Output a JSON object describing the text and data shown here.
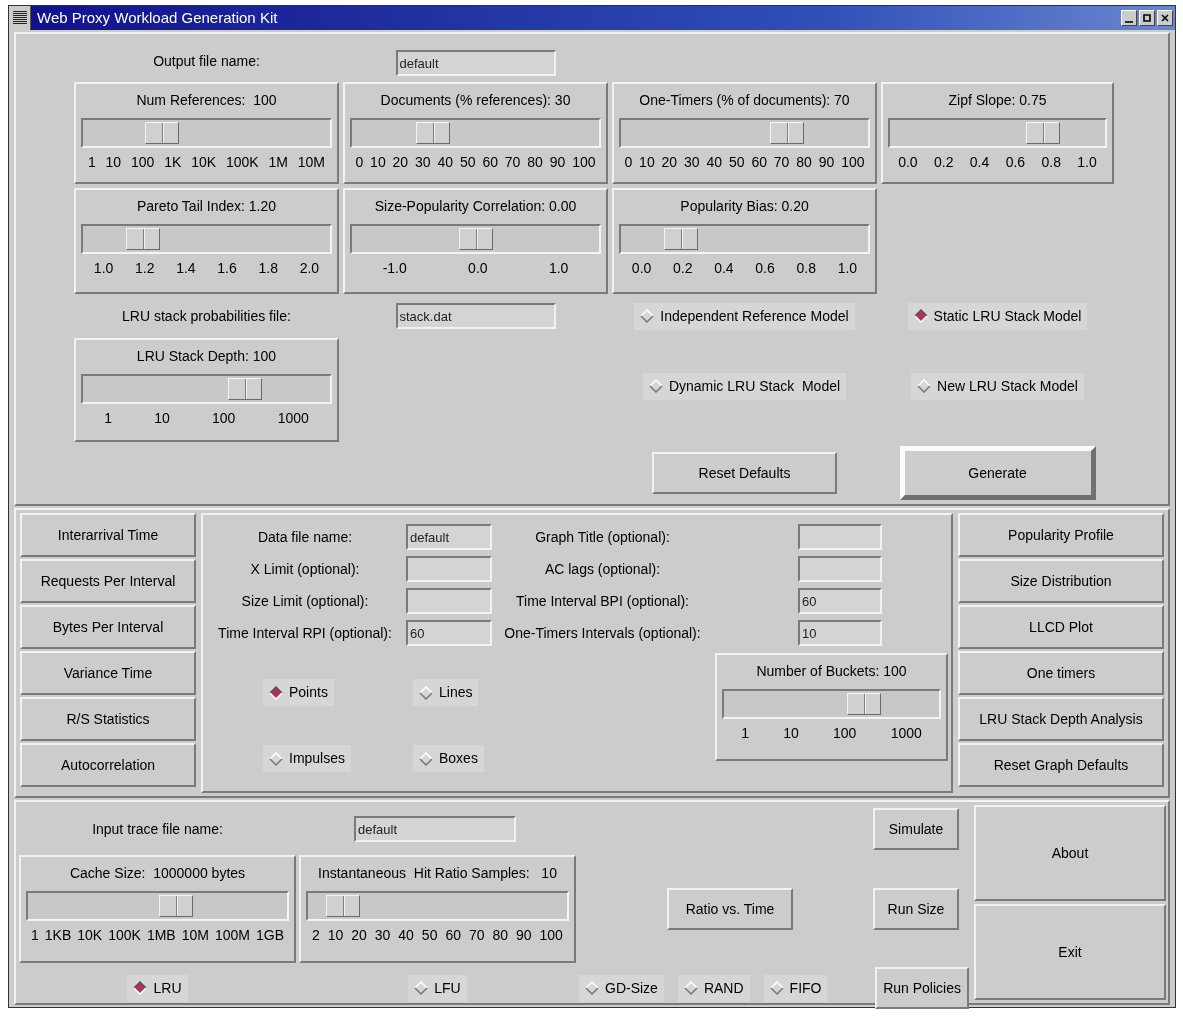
{
  "window": {
    "title": "Web Proxy Workload Generation Kit"
  },
  "generator": {
    "output_file": {
      "label": "Output file name:",
      "value": "default"
    },
    "scales": [
      {
        "label": "Num References:  100",
        "level": 0.29,
        "ticks": [
          "1",
          "10",
          "100",
          "1K",
          "10K",
          "100K",
          "1M",
          "10M"
        ]
      },
      {
        "label": "Documents (% references): 30",
        "level": 0.3,
        "ticks": [
          "0",
          "10",
          "20",
          "30",
          "40",
          "50",
          "60",
          "70",
          "80",
          "90",
          "100"
        ]
      },
      {
        "label": "One-Timers (% of documents): 70",
        "level": 0.7,
        "ticks": [
          "0",
          "10",
          "20",
          "30",
          "40",
          "50",
          "60",
          "70",
          "80",
          "90",
          "100"
        ]
      },
      {
        "label": "Zipf Slope: 0.75",
        "level": 0.75,
        "ticks": [
          "0.0",
          "0.2",
          "0.4",
          "0.6",
          "0.8",
          "1.0"
        ]
      },
      {
        "label": "Pareto Tail Index: 1.20",
        "level": 0.2,
        "ticks": [
          "1.0",
          "1.2",
          "1.4",
          "1.6",
          "1.8",
          "2.0"
        ]
      },
      {
        "label": "Size-Popularity Correlation: 0.00",
        "level": 0.5,
        "ticks": [
          "-1.0",
          "0.0",
          "1.0"
        ]
      },
      {
        "label": "Popularity Bias: 0.20",
        "level": 0.2,
        "ticks": [
          "0.0",
          "0.2",
          "0.4",
          "0.6",
          "0.8",
          "1.0"
        ]
      }
    ],
    "lru_file": {
      "label": "LRU stack probabilities file:",
      "value": "stack.dat"
    },
    "lru_depth": {
      "label": "LRU Stack Depth: 100",
      "level": 0.68,
      "ticks": [
        "1",
        "10",
        "100",
        "1000"
      ]
    },
    "models": [
      {
        "label": "Independent Reference Model",
        "selected": false
      },
      {
        "label": "Static LRU Stack Model",
        "selected": true
      },
      {
        "label": "Dynamic LRU Stack  Model",
        "selected": false
      },
      {
        "label": "New LRU Stack Model",
        "selected": false
      }
    ],
    "buttons": [
      "Reset Defaults",
      "Generate"
    ]
  },
  "analysis": {
    "plot_buttons": [
      "Interarrival Time",
      "Requests Per Interval",
      "Bytes Per Interval",
      "Variance Time",
      "R/S Statistics",
      "Autocorrelation"
    ],
    "fields": [
      {
        "label": "Data file name:",
        "value": "default"
      },
      {
        "label": "Graph Title (optional):"
      },
      {
        "label": "X Limit (optional):"
      },
      {
        "label": "AC lags (optional):"
      },
      {
        "label": "Size Limit (optional):"
      },
      {
        "label": "Time Interval BPI (optional):",
        "value": "60"
      },
      {
        "label": "Time Interval RPI (optional):",
        "value": "60"
      },
      {
        "label": "One-Timers Intervals (optional):",
        "value": "10"
      }
    ],
    "styles": [
      {
        "label": "Points",
        "selected": true
      },
      {
        "label": "Lines",
        "selected": false
      },
      {
        "label": "Impulses",
        "selected": false
      },
      {
        "label": "Boxes",
        "selected": false
      }
    ],
    "buckets": {
      "label": "Number of Buckets: 100",
      "level": 0.68,
      "ticks": [
        "1",
        "10",
        "100",
        "1000"
      ]
    },
    "graph_buttons": [
      "Popularity Profile",
      "Size Distribution",
      "LLCD Plot",
      "One timers",
      "LRU Stack Depth Analysis",
      "Reset Graph Defaults"
    ]
  },
  "simulation": {
    "input_file": {
      "label": "Input trace file name:",
      "value": "default"
    },
    "scales": [
      {
        "label": "Cache Size:  1000000 bytes",
        "level": 0.58,
        "ticks": [
          "1",
          "1KB",
          "10K",
          "100K",
          "1MB",
          "10M",
          "100M",
          "1GB"
        ]
      },
      {
        "label": "Instantaneous  Hit Ratio Samples:   10",
        "level": 0.08,
        "ticks": [
          "2",
          "10",
          "20",
          "30",
          "40",
          "50",
          "60",
          "70",
          "80",
          "90",
          "100"
        ]
      }
    ],
    "buttons": [
      "Simulate",
      "Ratio vs. Time",
      "Run Size",
      "Run Policies"
    ],
    "policies": [
      {
        "label": "LRU",
        "selected": true
      },
      {
        "label": "LFU",
        "selected": false
      },
      {
        "label": "GD-Size",
        "selected": false
      },
      {
        "label": "RAND",
        "selected": false
      },
      {
        "label": "FIFO",
        "selected": false
      }
    ],
    "side_buttons": [
      "About",
      "Exit"
    ]
  }
}
